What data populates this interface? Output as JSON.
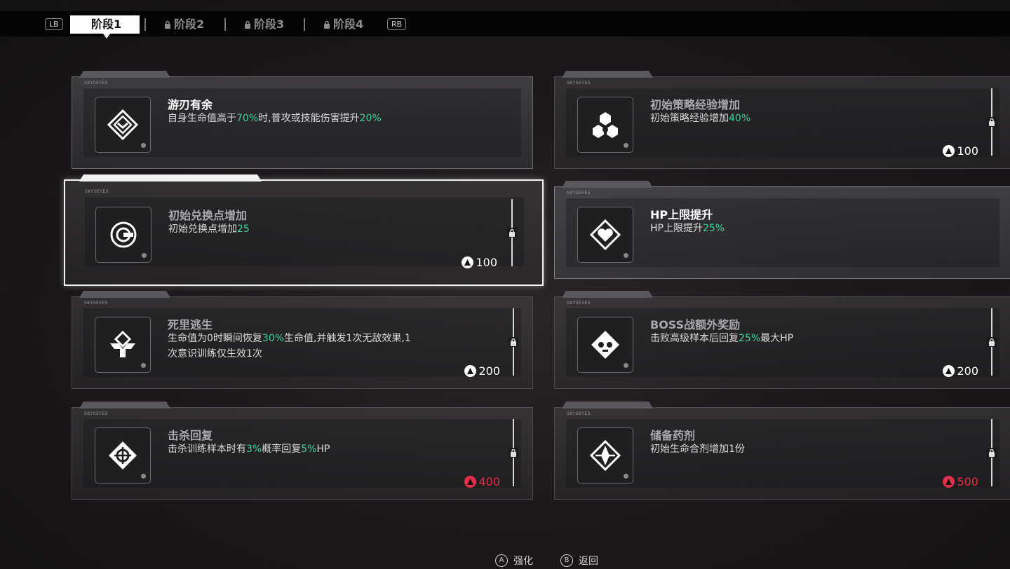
{
  "tabs": {
    "lb": "LB",
    "rb": "RB",
    "items": [
      {
        "label": "阶段1"
      },
      {
        "label": "阶段2"
      },
      {
        "label": "阶段3"
      },
      {
        "label": "阶段4"
      }
    ]
  },
  "card_code": "SKYSEYES",
  "cards": [
    {
      "title": "游刃有余",
      "desc_parts": [
        "自身生命值高于",
        "70%",
        "时,普攻或技能伤害提升",
        "20%",
        ""
      ],
      "cost": ""
    },
    {
      "title": "初始策略经验增加",
      "desc_parts": [
        "初始策略经验增加",
        "40%",
        "",
        "",
        ""
      ],
      "cost": "100"
    },
    {
      "title": "初始兑换点增加",
      "desc_parts": [
        "初始兑换点增加",
        "25",
        "",
        "",
        ""
      ],
      "cost": "100"
    },
    {
      "title": "HP上限提升",
      "desc_parts": [
        "HP上限提升",
        "25%",
        "",
        "",
        ""
      ],
      "cost": ""
    },
    {
      "title": "死里逃生",
      "desc_parts": [
        "生命值为0时瞬间恢复",
        "30%",
        "生命值,并触发1次无敌效果,1次意识训练仅生效1次",
        "",
        ""
      ],
      "cost": "200"
    },
    {
      "title": "BOSS战额外奖励",
      "desc_parts": [
        "击败高级样本后回复",
        "25%",
        "最大HP",
        "",
        ""
      ],
      "cost": "200"
    },
    {
      "title": "击杀回复",
      "desc_parts": [
        "击杀训练样本时有",
        "3%",
        "概率回复",
        "5%",
        "HP"
      ],
      "cost": "400"
    },
    {
      "title": "储备药剂",
      "desc_parts": [
        "初始生命合剂增加1份",
        "",
        "",
        "",
        ""
      ],
      "cost": "500"
    }
  ],
  "hints": {
    "confirm_key": "A",
    "confirm_label": "强化",
    "back_key": "B",
    "back_label": "返回"
  },
  "colors": {
    "highlight": "#3fd69b",
    "cost_insufficient": "#e0304a",
    "cost_normal": "#ffffff"
  }
}
